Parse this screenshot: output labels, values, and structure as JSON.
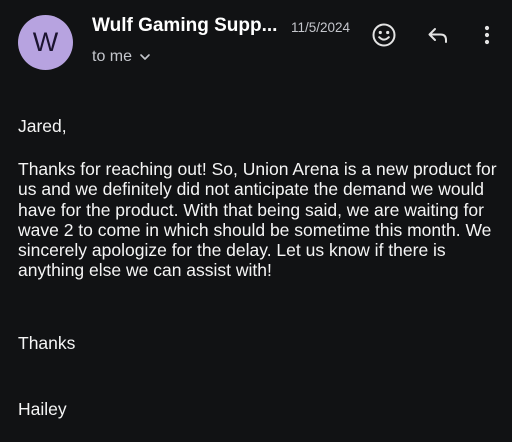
{
  "header": {
    "avatar_letter": "W",
    "sender_name": "Wulf Gaming Supp...",
    "date": "11/5/2024",
    "recipient_label": "to me"
  },
  "icons": {
    "emoji": "emoji-icon",
    "reply": "reply-icon",
    "more": "more-vertical-icon",
    "chevron": "chevron-down-icon"
  },
  "message": {
    "greeting": "Jared,",
    "body": "Thanks for reaching out! So, Union Arena is a new product for us and we definitely did not anticipate the demand we would have for the product. With that being said, we are waiting for wave 2 to come in which should be sometime this month. We sincerely apologize for the delay. Let us know if there is anything else we can assist with!",
    "closing": "Thanks",
    "signature": "Hailey"
  },
  "colors": {
    "background": "#111214",
    "avatar_bg": "#b7a3e0",
    "text": "#ffffff",
    "secondary_text": "#c4c6cc"
  }
}
